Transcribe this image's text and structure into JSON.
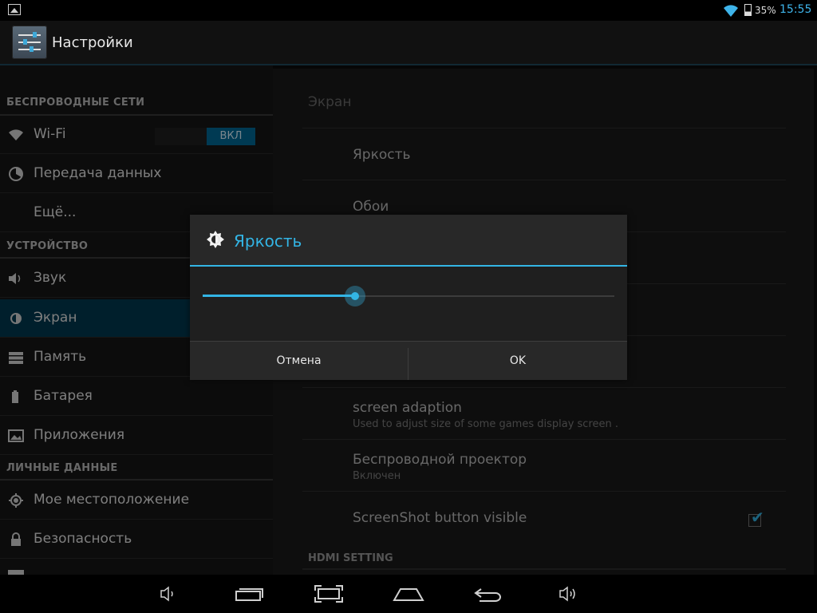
{
  "status": {
    "battery": "35%",
    "time": "15:55"
  },
  "app": {
    "title": "Настройки"
  },
  "left": {
    "sections": {
      "wireless": "БЕСПРОВОДНЫЕ СЕТИ",
      "device": "УСТРОЙСТВО",
      "personal": "ЛИЧНЫЕ ДАННЫЕ"
    },
    "items": [
      {
        "label": "Wi-Fi",
        "icon": "wifi-icon"
      },
      {
        "label": "Передача данных",
        "icon": "data-usage-icon"
      },
      {
        "label": "Ещё...",
        "icon": ""
      },
      {
        "label": "Звук",
        "icon": "speaker-icon"
      },
      {
        "label": "Экран",
        "icon": "brightness-icon"
      },
      {
        "label": "Память",
        "icon": "storage-icon"
      },
      {
        "label": "Батарея",
        "icon": "battery-icon"
      },
      {
        "label": "Приложения",
        "icon": "apps-icon"
      },
      {
        "label": "Мое местоположение",
        "icon": "location-icon"
      },
      {
        "label": "Безопасность",
        "icon": "lock-icon"
      }
    ],
    "wifi_toggle": "ВКЛ",
    "selected": "Экран"
  },
  "right": {
    "header": "Экран",
    "items": [
      {
        "title": "Яркость",
        "subtitle": ""
      },
      {
        "title": "Обои",
        "subtitle": ""
      },
      {
        "title": "screen adaption",
        "subtitle": "Used to adjust size of some games display screen ."
      },
      {
        "title": "Беспроводной проектор",
        "subtitle": "Включен"
      },
      {
        "title": "ScreenShot button visible",
        "subtitle": "",
        "checked": true
      }
    ],
    "hdmi_header": "HDMI SETTING"
  },
  "dialog": {
    "title": "Яркость",
    "brightness": 0.37,
    "cancel": "Отмена",
    "ok": "OK"
  },
  "colors": {
    "accent": "#33b5e5",
    "selected": "#003a50"
  }
}
